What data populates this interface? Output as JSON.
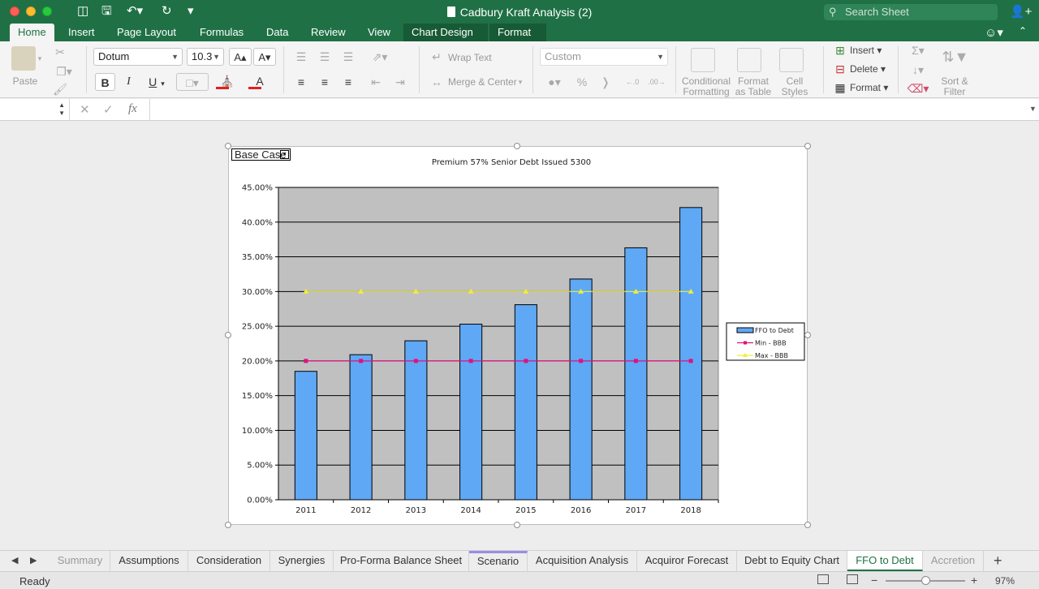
{
  "window": {
    "title": "Cadbury Kraft Analysis (2)",
    "search_placeholder": "Search Sheet"
  },
  "ribbon_tabs": [
    {
      "label": "Home"
    },
    {
      "label": "Insert"
    },
    {
      "label": "Page Layout"
    },
    {
      "label": "Formulas"
    },
    {
      "label": "Data"
    },
    {
      "label": "Review"
    },
    {
      "label": "View"
    },
    {
      "label": "Chart Design"
    },
    {
      "label": "Format"
    }
  ],
  "ribbon": {
    "paste_label": "Paste",
    "font_name": "Dotum",
    "font_size": "10.3",
    "wrap_text": "Wrap Text",
    "merge_center": "Merge & Center",
    "number_format": "Custom",
    "conditional_formatting": [
      "Conditional",
      "Formatting"
    ],
    "format_as_table": [
      "Format",
      "as Table"
    ],
    "cell_styles": [
      "Cell",
      "Styles"
    ],
    "insert": "Insert",
    "delete": "Delete",
    "format": "Format",
    "sort_filter": [
      "Sort &",
      "Filter"
    ]
  },
  "formula_bar": {
    "name_box": "",
    "content": ""
  },
  "scenario_dropdown": "Base Case",
  "chart_data": {
    "type": "bar",
    "title": "Premium 57% Senior Debt Issued 5300",
    "categories": [
      "2011",
      "2012",
      "2013",
      "2014",
      "2015",
      "2016",
      "2017",
      "2018"
    ],
    "series": [
      {
        "name": "FFO to Debt",
        "type": "bar",
        "color": "#5fa8f5",
        "values": [
          18.5,
          20.9,
          22.9,
          25.3,
          28.1,
          31.8,
          36.3,
          42.1
        ]
      },
      {
        "name": "Min - BBB",
        "type": "line",
        "color": "#e0107f",
        "values": [
          20,
          20,
          20,
          20,
          20,
          20,
          20,
          20
        ]
      },
      {
        "name": "Max - BBB",
        "type": "line",
        "color": "#f2ec3a",
        "values": [
          30,
          30,
          30,
          30,
          30,
          30,
          30,
          30
        ]
      }
    ],
    "y_ticks": [
      "0.00%",
      "5.00%",
      "10.00%",
      "15.00%",
      "20.00%",
      "25.00%",
      "30.00%",
      "35.00%",
      "40.00%",
      "45.00%"
    ],
    "ylim": [
      0,
      45
    ],
    "grid": true,
    "plot_background": "#c0c0c0",
    "legend_position": "right"
  },
  "sheet_tabs": [
    {
      "label": "Summary"
    },
    {
      "label": "Assumptions"
    },
    {
      "label": "Consideration"
    },
    {
      "label": "Synergies"
    },
    {
      "label": "Pro-Forma Balance Sheet"
    },
    {
      "label": "Scenario"
    },
    {
      "label": "Acquisition Analysis"
    },
    {
      "label": "Acquiror Forecast"
    },
    {
      "label": "Debt to Equity Chart"
    },
    {
      "label": "FFO to Debt"
    },
    {
      "label": "Accretion"
    }
  ],
  "status": {
    "text": "Ready",
    "zoom": "97%",
    "zoom_fraction": 0.5
  },
  "colors": {
    "accent": "#1f7145"
  }
}
